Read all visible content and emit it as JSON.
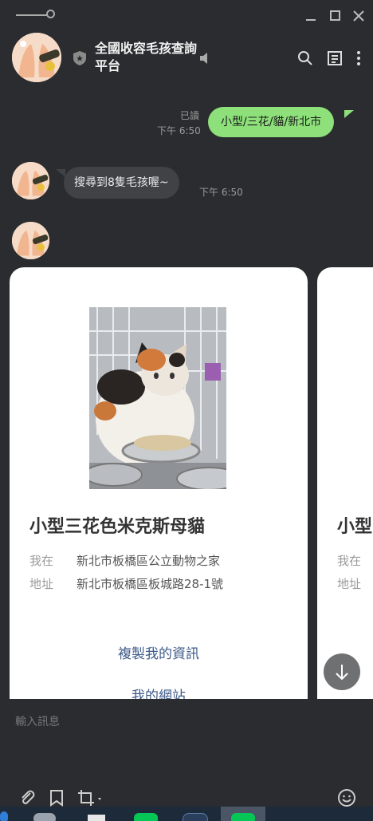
{
  "chat": {
    "title": "全國收容毛孩查詢平台",
    "messages": {
      "sent_text": "小型/三花/貓/新北市",
      "sent_read": "已讀",
      "sent_time": "下午 6:50",
      "reply_text": "搜尋到8隻毛孩喔~",
      "reply_time": "下午 6:50"
    }
  },
  "cards": [
    {
      "title": "小型三花色米克斯母貓",
      "location_label": "我在",
      "location_value": "新北市板橋區公立動物之家",
      "address_label": "地址",
      "address_value": "新北市板橋區板城路28-1號",
      "action_copy": "複製我的資訊",
      "action_site": "我的網站"
    },
    {
      "title": "小型",
      "location_label": "我在",
      "address_label": "地址"
    }
  ],
  "input": {
    "placeholder": "輸入訊息"
  },
  "colors": {
    "background": "#2b2c2f",
    "sent_bubble": "#8de07a",
    "received_bubble": "#414246",
    "link": "#3d5a8a"
  }
}
